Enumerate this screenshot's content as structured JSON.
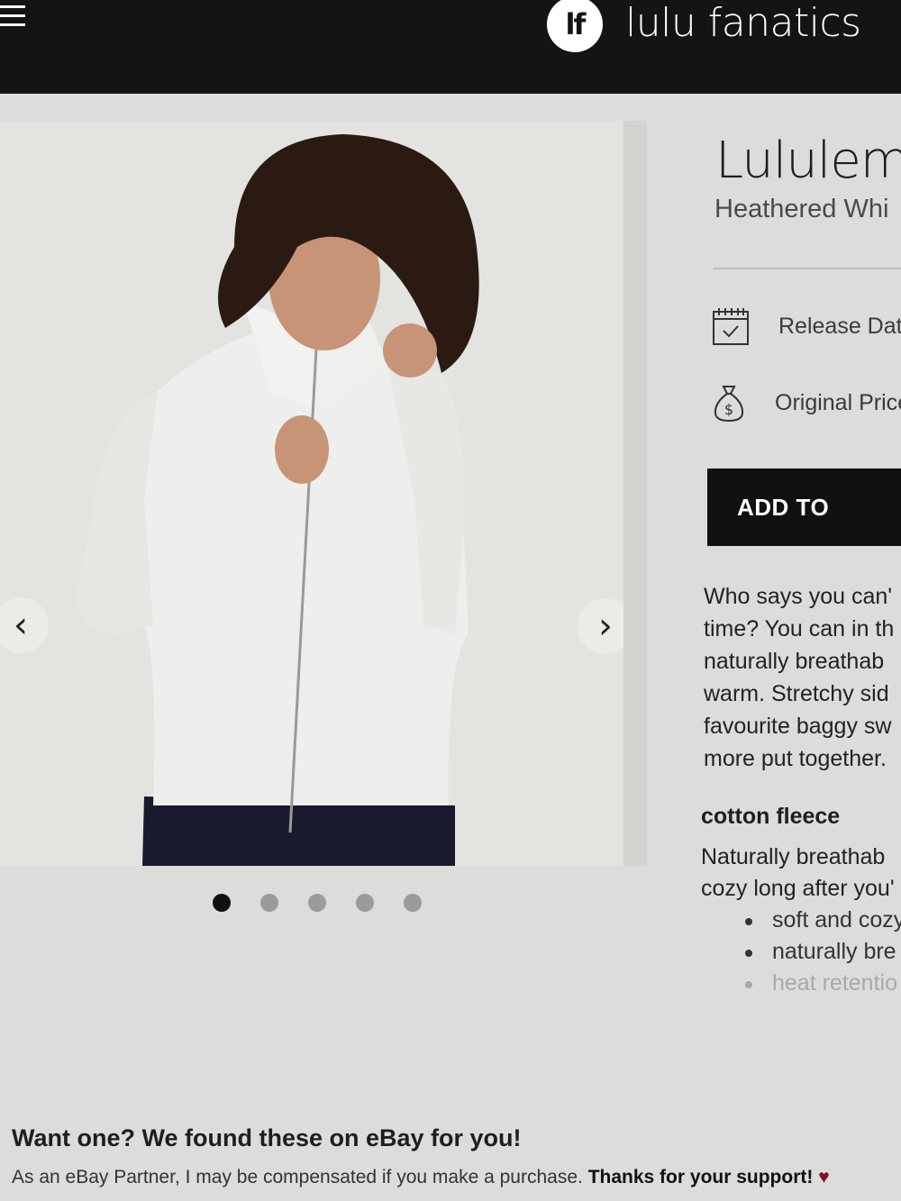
{
  "header": {
    "logo_text": "lf",
    "brand_name": "lulu fanatics"
  },
  "product": {
    "title": "Lululem",
    "subtitle": "Heathered Whi",
    "release_date_label": "Release Date",
    "original_price_label": "Original Price",
    "add_button_label": "ADD TO",
    "description_lines": [
      "Who says you can'",
      "time? You can in th",
      "naturally breathab",
      "warm. Stretchy sid",
      "favourite baggy sw",
      "more put together."
    ],
    "fabric_title": "cotton fleece",
    "fabric_lines": [
      "Naturally breathab",
      "cozy long after you'"
    ],
    "features": [
      "soft and cozy",
      "naturally bre",
      "heat retentio"
    ]
  },
  "gallery": {
    "prev_glyph": "‹",
    "next_glyph": "›",
    "slide_count": 5,
    "active_slide": 1
  },
  "ebay": {
    "title": "Want one? We found these on eBay for you!",
    "note": "As an eBay Partner, I may be compensated if you make a purchase.",
    "thanks": "Thanks for your support!",
    "heart": "♥"
  },
  "colors": {
    "header_bg": "#141414",
    "button_bg": "#111111",
    "page_bg": "#dcdcda",
    "heart": "#7a1426"
  },
  "icons": [
    "menu-icon",
    "calendar-check-icon",
    "money-bag-icon",
    "chevron-left-icon",
    "chevron-right-icon",
    "heart-icon"
  ]
}
